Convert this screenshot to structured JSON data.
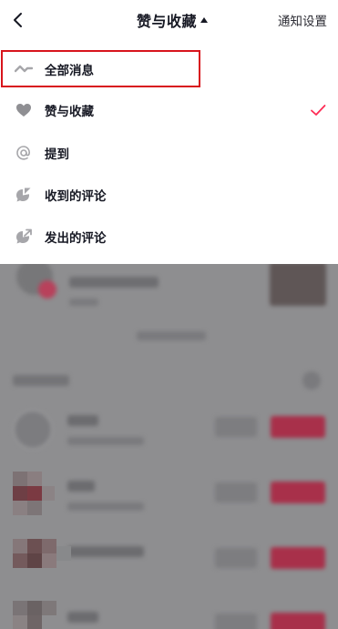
{
  "header": {
    "back_icon": "back-chevron-icon",
    "title": "赞与收藏",
    "title_caret_icon": "caret-up-icon",
    "settings_link": "通知设置"
  },
  "menu": {
    "items": [
      {
        "label": "全部消息",
        "icon": "wave-icon",
        "selected": false
      },
      {
        "label": "赞与收藏",
        "icon": "heart-icon",
        "selected": true
      },
      {
        "label": "提到",
        "icon": "at-icon",
        "selected": false
      },
      {
        "label": "收到的评论",
        "icon": "comment-received-icon",
        "selected": false
      },
      {
        "label": "发出的评论",
        "icon": "comment-sent-icon",
        "selected": false
      }
    ],
    "check_icon": "checkmark-icon"
  },
  "colors": {
    "accent": "#fe2c55",
    "annotation_box": "#d8141c",
    "text_primary": "#161823",
    "icon_grey": "#a6a6aa",
    "overlay": "#8e8e90"
  }
}
